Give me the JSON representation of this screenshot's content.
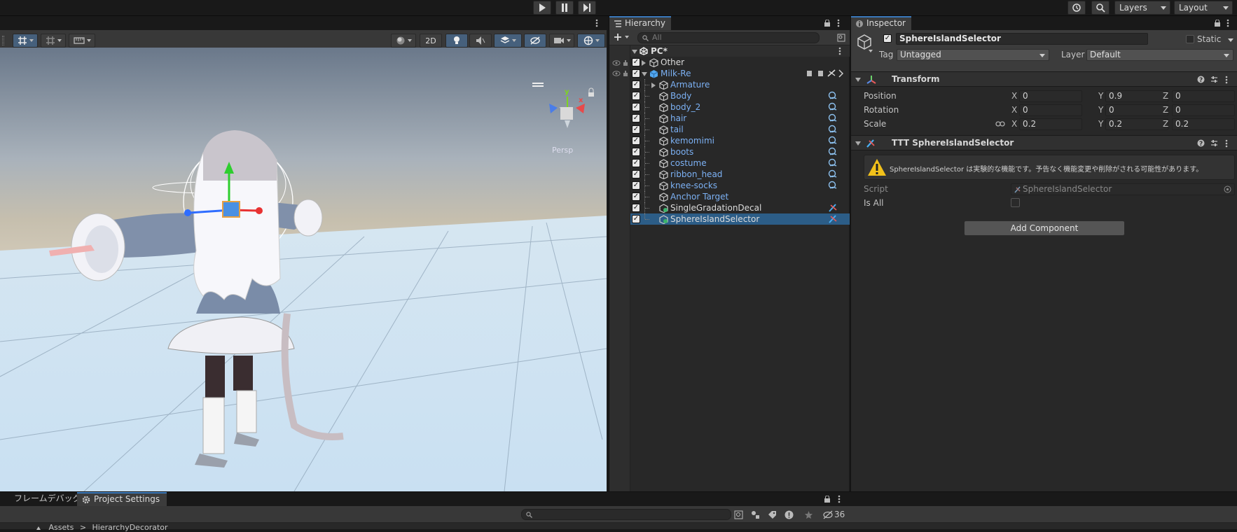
{
  "toolbar": {
    "layers_label": "Layers",
    "layout_label": "Layout"
  },
  "scene": {
    "toggle_2d": "2D",
    "view_label": "Persp"
  },
  "hierarchy": {
    "tab_label": "Hierarchy",
    "search_placeholder": "All",
    "scene_name": "PC*",
    "rows": [
      {
        "name": "Other",
        "depth": 1,
        "color": "white",
        "expander": "collapsed"
      },
      {
        "name": "Milk-Re",
        "depth": 1,
        "color": "blue",
        "expander": "expanded"
      },
      {
        "name": "Armature",
        "depth": 2,
        "color": "blue",
        "expander": "collapsed"
      },
      {
        "name": "Body",
        "depth": 2,
        "color": "blue"
      },
      {
        "name": "body_2",
        "depth": 2,
        "color": "blue"
      },
      {
        "name": "hair",
        "depth": 2,
        "color": "blue"
      },
      {
        "name": "tail",
        "depth": 2,
        "color": "blue"
      },
      {
        "name": "kemomimi",
        "depth": 2,
        "color": "blue"
      },
      {
        "name": "boots",
        "depth": 2,
        "color": "blue"
      },
      {
        "name": "costume",
        "depth": 2,
        "color": "blue"
      },
      {
        "name": "ribbon_head",
        "depth": 2,
        "color": "blue"
      },
      {
        "name": "knee-socks",
        "depth": 2,
        "color": "blue"
      },
      {
        "name": "Anchor Target",
        "depth": 2,
        "color": "blue"
      },
      {
        "name": "SingleGradationDecal",
        "depth": 2,
        "color": "white"
      },
      {
        "name": "SphereIslandSelector",
        "depth": 2,
        "color": "white",
        "selected": true
      }
    ]
  },
  "inspector": {
    "tab_label": "Inspector",
    "object_name": "SphereIslandSelector",
    "static_label": "Static",
    "tag_label": "Tag",
    "tag_value": "Untagged",
    "layer_label": "Layer",
    "layer_value": "Default",
    "transform": {
      "title": "Transform",
      "position_label": "Position",
      "rotation_label": "Rotation",
      "scale_label": "Scale",
      "position": {
        "x": "0",
        "y": "0.9",
        "z": "0"
      },
      "rotation": {
        "x": "0",
        "y": "0",
        "z": "0"
      },
      "scale": {
        "x": "0.2",
        "y": "0.2",
        "z": "0.2"
      }
    },
    "ttt": {
      "title": "TTT SphereIslandSelector",
      "warning": "SphereIslandSelector は実験的な機能です。予告なく機能変更や削除がされる可能性があります。",
      "script_label": "Script",
      "script_value": "SphereIslandSelector",
      "is_all_label": "Is All"
    },
    "add_component": "Add Component"
  },
  "axis_labels": {
    "x": "X",
    "y": "Y",
    "z": "Z"
  },
  "bottom": {
    "tab1": "フレームデバッグ",
    "tab2": "Project Settings",
    "path_root": "Assets",
    "path_sep": ">",
    "path_leaf": "HierarchyDecorator",
    "hidden_count": "36"
  },
  "colors": {
    "accent_blue": "#3a79bb",
    "selection": "#2c5d87",
    "prefab_blue": "#7cb1f4"
  }
}
